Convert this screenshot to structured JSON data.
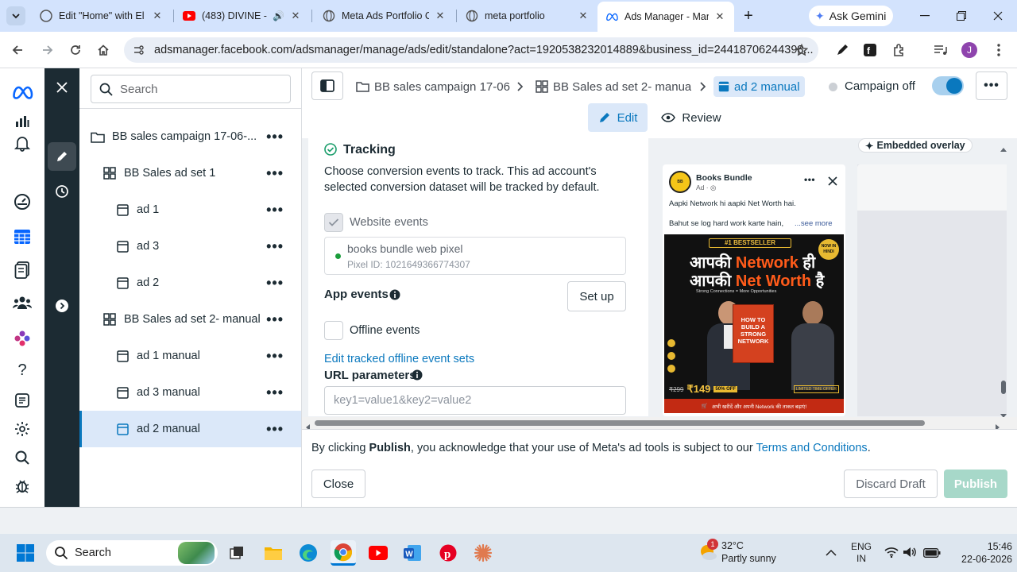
{
  "browser": {
    "tabs": [
      {
        "title": "Edit \"Home\" with El",
        "icon": "elementor-icon"
      },
      {
        "title": "(483) DIVINE - M",
        "icon": "youtube-icon"
      },
      {
        "title": "Meta Ads Portfolio C",
        "icon": "globe-icon"
      },
      {
        "title": "meta portfolio",
        "icon": "globe-icon"
      },
      {
        "title": "Ads Manager - Man",
        "icon": "meta-icon"
      }
    ],
    "new_tab": "+",
    "gemini_label": "Ask Gemini",
    "url": "adsmanager.facebook.com/adsmanager/manage/ads/edit/standalone?act=1920538232014889&business_id=24418706244398...",
    "profile_initial": "J"
  },
  "tree": {
    "search_placeholder": "Search",
    "items": [
      {
        "label": "BB sales campaign 17-06-...",
        "type": "campaign"
      },
      {
        "label": "BB Sales ad set 1",
        "type": "adset"
      },
      {
        "label": "ad 1",
        "type": "ad"
      },
      {
        "label": "ad 3",
        "type": "ad"
      },
      {
        "label": "ad 2",
        "type": "ad"
      },
      {
        "label": "BB Sales ad set 2- manual",
        "type": "adset"
      },
      {
        "label": "ad 1 manual",
        "type": "ad"
      },
      {
        "label": "ad 3 manual",
        "type": "ad"
      },
      {
        "label": "ad 2 manual",
        "type": "ad"
      }
    ],
    "more": "•••"
  },
  "header": {
    "crumb_campaign": "BB sales campaign 17-06",
    "crumb_adset": "BB Sales ad set 2- manua",
    "crumb_ad": "ad 2 manual",
    "campaign_status": "Campaign off",
    "edit_label": "Edit",
    "review_label": "Review"
  },
  "form": {
    "tracking_title": "Tracking",
    "tracking_desc": "Choose conversion events to track. This ad account's selected conversion dataset will be tracked by default.",
    "website_events": "Website events",
    "pixel_name": "books bundle web pixel",
    "pixel_id": "Pixel ID: 1021649366774307",
    "app_events": "App events",
    "setup_label": "Set up",
    "offline_events": "Offline events",
    "edit_offline_link": "Edit tracked offline event sets",
    "url_params": "URL parameters",
    "url_placeholder": "key1=value1&key2=value2"
  },
  "preview": {
    "overlay_label": "Embedded overlay",
    "page_name": "Books Bundle",
    "sponsored": "Ad · ",
    "line1": "Aapki Network hi aapki Net Worth hai.",
    "line2": "Bahut se log hard work karte hain,",
    "see_more": "...see more",
    "creative": {
      "bestseller": "#1 BESTSELLER",
      "headline1_a": "आपकी ",
      "headline1_b": "Network",
      "headline1_c": " ही",
      "headline2_a": "आपकी ",
      "headline2_b": "Net Worth",
      "headline2_c": " है",
      "tagline": "Strong Connections = More Opportunities",
      "book_title": "HOW TO BUILD A STRONG NETWORK",
      "now_in": "NOW IN HINDI",
      "price_old": "₹299",
      "price_new": "₹149",
      "discount": "50% OFF",
      "limited": "LIMITED TIME OFFER",
      "cta": "अभी खरीदें और अपनी Network की ताकत बढ़ाएं!"
    }
  },
  "footer": {
    "text_prefix": "By clicking ",
    "text_bold": "Publish",
    "text_mid": ", you acknowledge that your use of Meta's ad tools is subject to our ",
    "terms_link": "Terms and Conditions",
    "text_end": ".",
    "close_label": "Close",
    "discard_label": "Discard Draft",
    "publish_label": "Publish"
  },
  "taskbar": {
    "search_label": "Search",
    "weather_temp": "32°C",
    "weather_desc": "Partly sunny",
    "weather_badge": "1",
    "lang_line1": "ENG",
    "lang_line2": "IN",
    "time": "15:46",
    "date": "22-06-2026"
  },
  "colors": {
    "meta_blue": "#0866ff",
    "link_blue": "#0a78be",
    "rail_dark": "#1c2b33",
    "selected_bg": "#dbe8f9",
    "publish_disabled": "#a7d8c9"
  }
}
